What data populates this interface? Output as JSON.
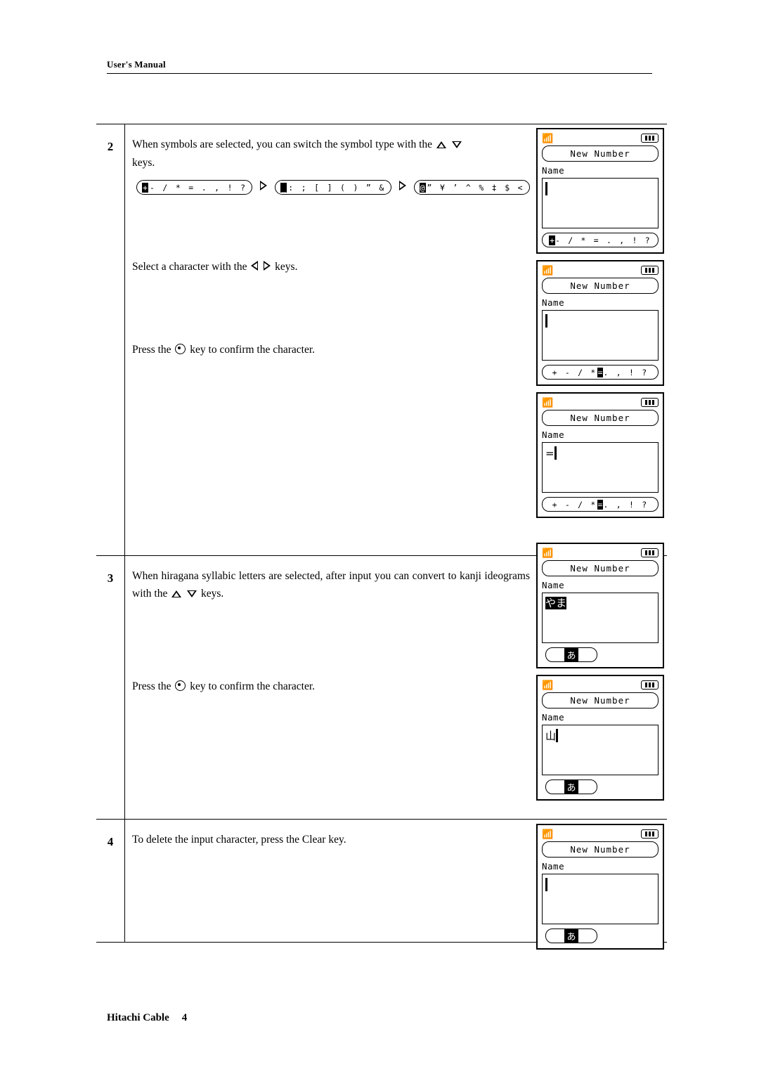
{
  "header": {
    "title": "User's Manual"
  },
  "footer": {
    "brand": "Hitachi Cable",
    "page": "4"
  },
  "steps": [
    {
      "number": "2",
      "lines": [
        "When symbols are selected, you can switch the symbol type with the",
        "keys."
      ],
      "text_a": "When symbols are selected, you can switch the symbol type with the",
      "text_a_tail": "keys.",
      "text_b_pre": "Select a character with the",
      "text_b_post": "keys.",
      "text_c_pre": "Press the",
      "text_c_post": "key to confirm the character.",
      "palette": [
        {
          "selected": "+",
          "rest": "- / * = . , ! ?"
        },
        {
          "selected": "_",
          "rest": ": ; [ ] ( ) ” &"
        },
        {
          "selected": "@",
          "rest": "” ¥ ’ ^ % ‡ $ <"
        }
      ]
    },
    {
      "number": "3",
      "text_a": "When hiragana syllabic letters are selected, after input you can convert to kanji ideograms with the",
      "text_a_tail": "keys.",
      "text_c_pre": "Press the",
      "text_c_post": "key to confirm the character."
    },
    {
      "number": "4",
      "text_a": "To delete the input character, press the Clear key."
    }
  ],
  "phone": {
    "title": "New Number",
    "field_label": "Name",
    "soft_symbols_1": {
      "selected": "+",
      "rest": "- / * = . , ! ?"
    },
    "soft_symbols_2": {
      "pre": "+ - / *",
      "selected": "=",
      "post": ". , ! ?"
    },
    "kana_label": "あ",
    "screen_hira": "やま",
    "screen_kanji": "山",
    "screen_equals": "="
  }
}
